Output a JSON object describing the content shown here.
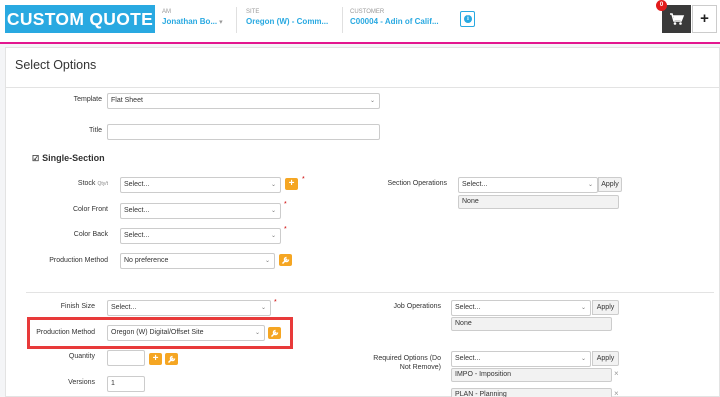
{
  "header": {
    "title": "CUSTOM QUOTE",
    "am": {
      "label": "AM",
      "value": "Jonathan Bo..."
    },
    "site": {
      "label": "SITE",
      "value": "Oregon (W) - Comm..."
    },
    "customer": {
      "label": "CUSTOMER",
      "value": "C00004 - Adin of Calif..."
    },
    "cart_count": "0",
    "info_glyph": "i",
    "plus_glyph": "+"
  },
  "panel": {
    "title": "Select Options"
  },
  "form": {
    "template": {
      "label": "Template",
      "value": "Flat Sheet"
    },
    "title_field": {
      "label": "Title",
      "value": ""
    },
    "section_title": "Single-Section",
    "stock": {
      "label": "Stock",
      "sub": "Qty/t",
      "value": "Select..."
    },
    "color_front": {
      "label": "Color Front",
      "value": "Select..."
    },
    "color_back": {
      "label": "Color Back",
      "value": "Select..."
    },
    "production_method_section": {
      "label": "Production Method",
      "value": "No preference"
    },
    "section_operations": {
      "label": "Section Operations",
      "value": "Select...",
      "apply": "Apply",
      "selected": "None"
    },
    "finish_size": {
      "label": "Finish Size",
      "value": "Select..."
    },
    "production_method_job": {
      "label": "Production Method",
      "value": "Oregon (W) Digital/Offset Site"
    },
    "quantity": {
      "label": "Quantity",
      "value": ""
    },
    "versions": {
      "label": "Versions",
      "value": "1"
    },
    "job_operations": {
      "label": "Job Operations",
      "value": "Select...",
      "apply": "Apply",
      "selected": "None"
    },
    "required_options": {
      "label_line1": "Required Options (Do",
      "label_line2": "Not Remove)",
      "value": "Select...",
      "apply": "Apply",
      "items": [
        "IMPO - Imposition",
        "PLAN - Planning"
      ]
    },
    "required_mark": "*",
    "caret": "⌄",
    "remove_glyph": "×"
  }
}
